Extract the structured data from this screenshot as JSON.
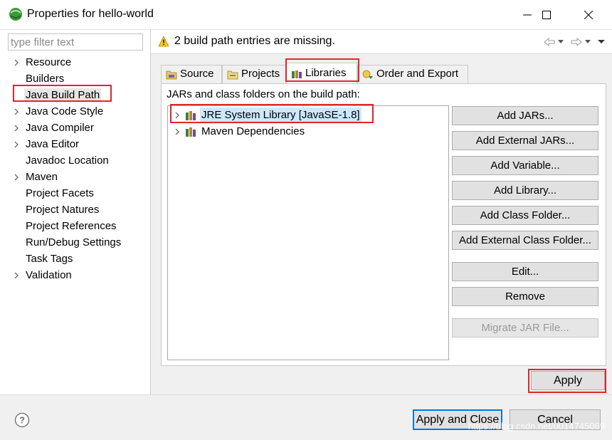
{
  "window": {
    "title": "Properties for hello-world"
  },
  "sidebar": {
    "filter_placeholder": "type filter text",
    "items": [
      {
        "label": "Resource",
        "expandable": true,
        "selected": false
      },
      {
        "label": "Builders",
        "expandable": false,
        "selected": false
      },
      {
        "label": "Java Build Path",
        "expandable": false,
        "selected": true
      },
      {
        "label": "Java Code Style",
        "expandable": true,
        "selected": false
      },
      {
        "label": "Java Compiler",
        "expandable": true,
        "selected": false
      },
      {
        "label": "Java Editor",
        "expandable": true,
        "selected": false
      },
      {
        "label": "Javadoc Location",
        "expandable": false,
        "selected": false
      },
      {
        "label": "Maven",
        "expandable": true,
        "selected": false
      },
      {
        "label": "Project Facets",
        "expandable": false,
        "selected": false
      },
      {
        "label": "Project Natures",
        "expandable": false,
        "selected": false
      },
      {
        "label": "Project References",
        "expandable": false,
        "selected": false
      },
      {
        "label": "Run/Debug Settings",
        "expandable": false,
        "selected": false
      },
      {
        "label": "Task Tags",
        "expandable": false,
        "selected": false
      },
      {
        "label": "Validation",
        "expandable": true,
        "selected": false
      }
    ]
  },
  "message": {
    "text": "2 build path entries are missing.",
    "icon": "warning-icon"
  },
  "tabs": [
    {
      "label": "Source",
      "icon": "source-folder-icon",
      "active": false
    },
    {
      "label": "Projects",
      "icon": "projects-icon",
      "active": false
    },
    {
      "label": "Libraries",
      "icon": "library-icon",
      "active": true
    },
    {
      "label": "Order and Export",
      "icon": "order-export-icon",
      "active": false
    }
  ],
  "libraries": {
    "heading": "JARs and class folders on the build path:",
    "entries": [
      {
        "label": "JRE System Library [JavaSE-1.8]",
        "selected": true
      },
      {
        "label": "Maven Dependencies",
        "selected": false
      }
    ]
  },
  "buttons": {
    "add_jars": "Add JARs...",
    "add_external_jars": "Add External JARs...",
    "add_variable": "Add Variable...",
    "add_library": "Add Library...",
    "add_class_folder": "Add Class Folder...",
    "add_external_class_folder": "Add External Class Folder...",
    "edit": "Edit...",
    "remove": "Remove",
    "migrate_jar": "Migrate JAR File..."
  },
  "apply": "Apply",
  "footer": {
    "apply_and_close": "Apply and Close",
    "cancel": "Cancel",
    "watermark": "https://blog.csdn.net/u014745069"
  },
  "colors": {
    "highlight": "#e0262a",
    "selection": "#cce8ff",
    "default_button_border": "#0078d7",
    "warning": "#f5c518"
  }
}
